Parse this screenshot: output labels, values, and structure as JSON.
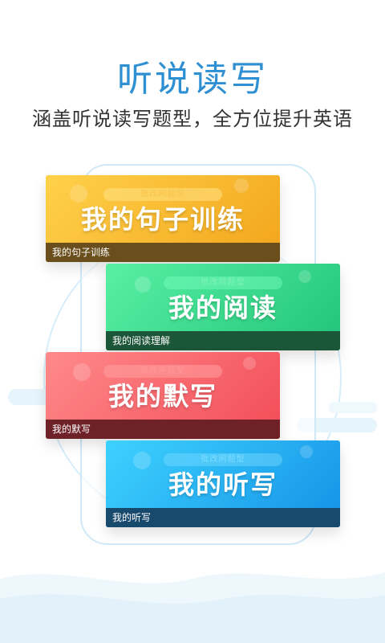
{
  "header": {
    "title": "听说读写",
    "subtitle": "涵盖听说读写题型，全方位提升英语"
  },
  "colors": {
    "title": "#2f8fd3",
    "card_yellow": "#f7b92e",
    "card_green": "#2ed98c",
    "card_red": "#f76468",
    "card_blue": "#24b4f4"
  },
  "cards": [
    {
      "pill": "批改网题型",
      "title": "我的句子训练",
      "footer": "我的句子训练"
    },
    {
      "pill": "批改网题型",
      "title": "我的阅读",
      "footer": "我的阅读理解"
    },
    {
      "pill": "批改网题型",
      "title": "我的默写",
      "footer": "我的默写"
    },
    {
      "pill": "批改网题型",
      "title": "我的听写",
      "footer": "我的听写"
    }
  ]
}
